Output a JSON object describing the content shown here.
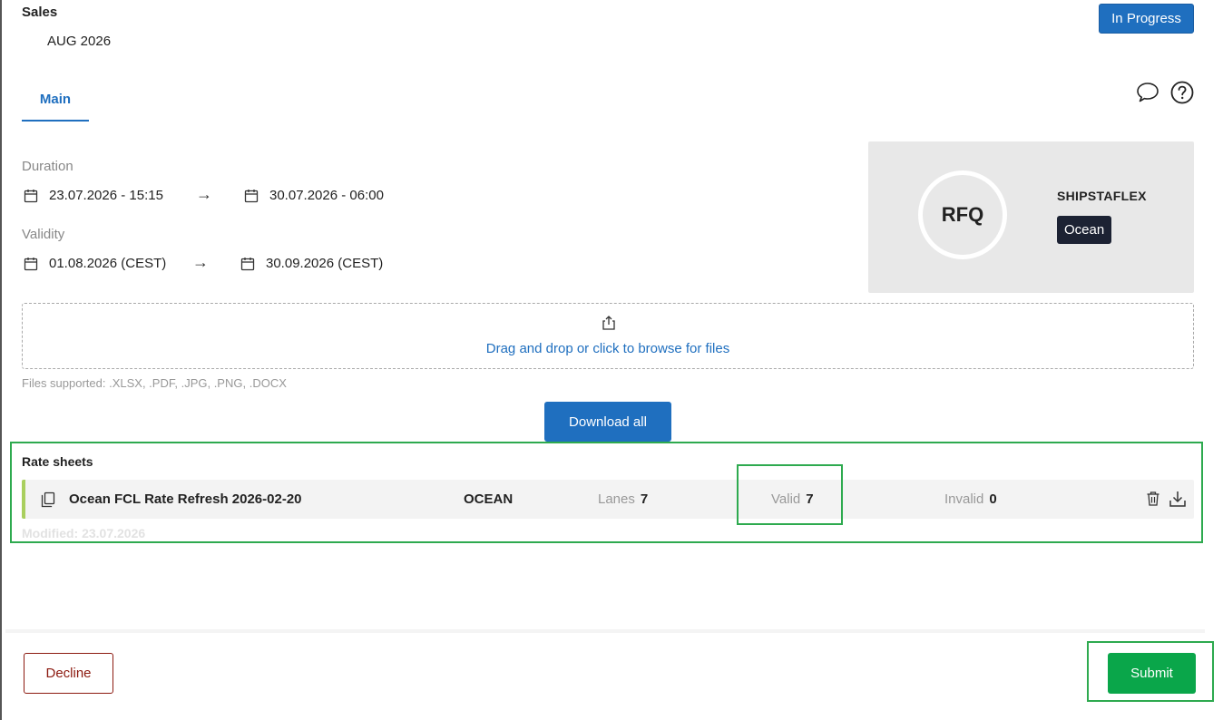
{
  "header": {
    "title": "Sales",
    "subtitle": "AUG 2026",
    "status": "In Progress"
  },
  "tabs": [
    {
      "label": "Main",
      "active": true
    }
  ],
  "icons": {
    "chat": "chat-bubble-icon",
    "help": "question-circle-icon"
  },
  "duration": {
    "label": "Duration",
    "start": "23.07.2026 - 15:15",
    "end": "30.07.2026 - 06:00"
  },
  "validity": {
    "label": "Validity",
    "start": "01.08.2026 (CEST)",
    "end": "30.09.2026 (CEST)"
  },
  "arrow_glyph": "→",
  "rfq_card": {
    "badge": "RFQ",
    "company": "SHIPSTAFLEX",
    "mode_tag": "Ocean"
  },
  "upload": {
    "text": "Drag and drop or click to browse for files",
    "supported": "Files supported: .XLSX, .PDF, .JPG, .PNG, .DOCX"
  },
  "download_all_label": "Download all",
  "rate_sheets": {
    "title": "Rate sheets",
    "items": [
      {
        "name": "Ocean FCL Rate Refresh 2026-02-20",
        "mode": "OCEAN",
        "lanes_label": "Lanes",
        "lanes": "7",
        "valid_label": "Valid",
        "valid": "7",
        "invalid_label": "Invalid",
        "invalid": "0",
        "modified": "Modified:  23.07.2026"
      }
    ]
  },
  "footer": {
    "decline_label": "Decline",
    "submit_label": "Submit"
  },
  "colors": {
    "primary": "#1f6fbf",
    "submit": "#0aa64a",
    "decline": "#8c1a10",
    "highlight": "#2eaa4f",
    "tag_dark": "#1c2233"
  }
}
